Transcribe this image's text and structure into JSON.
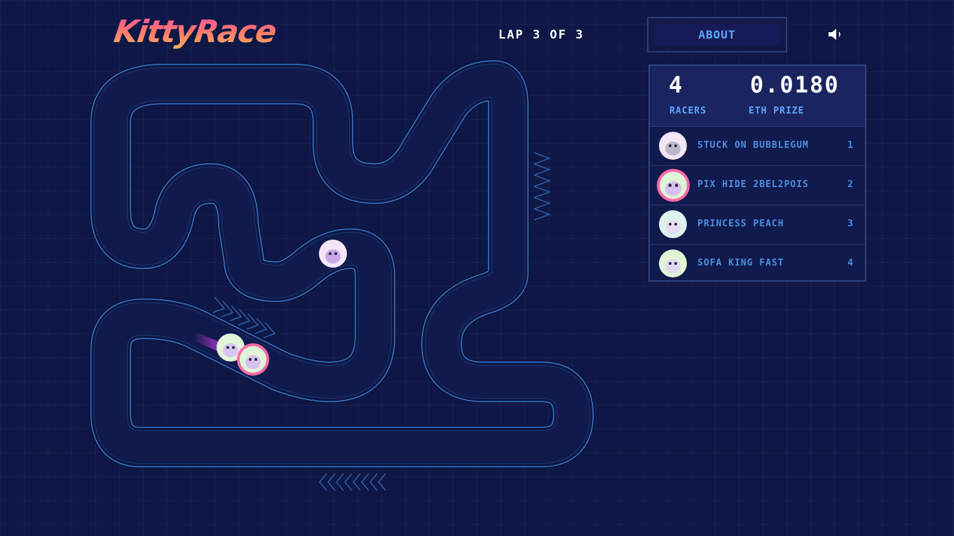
{
  "header": {
    "logo": "KittyRace",
    "lap": "LAP 3 OF 3",
    "about_label": "ABOUT",
    "sound_icon": "speaker-icon"
  },
  "stats": {
    "racers_value": "4",
    "racers_label": "RACERS",
    "prize_value": "0.0180",
    "prize_label": "ETH PRIZE"
  },
  "leaderboard": [
    {
      "name": "STUCK ON BUBBLEGUM",
      "position": "1",
      "color": "#f3e6f6",
      "highlight": false
    },
    {
      "name": "PIX HIDE 2BEL2POIS",
      "position": "2",
      "color": "#dff5d8",
      "highlight": true
    },
    {
      "name": "PRINCESS PEACH",
      "position": "3",
      "color": "#dcf3ee",
      "highlight": false
    },
    {
      "name": "SOFA KING FAST",
      "position": "4",
      "color": "#e3f5d5",
      "highlight": false
    }
  ],
  "colors": {
    "background": "#0e1745",
    "accent": "#5ea6ff",
    "track_line": "#3f8fe6",
    "highlight_ring": "#ff6aa8"
  }
}
